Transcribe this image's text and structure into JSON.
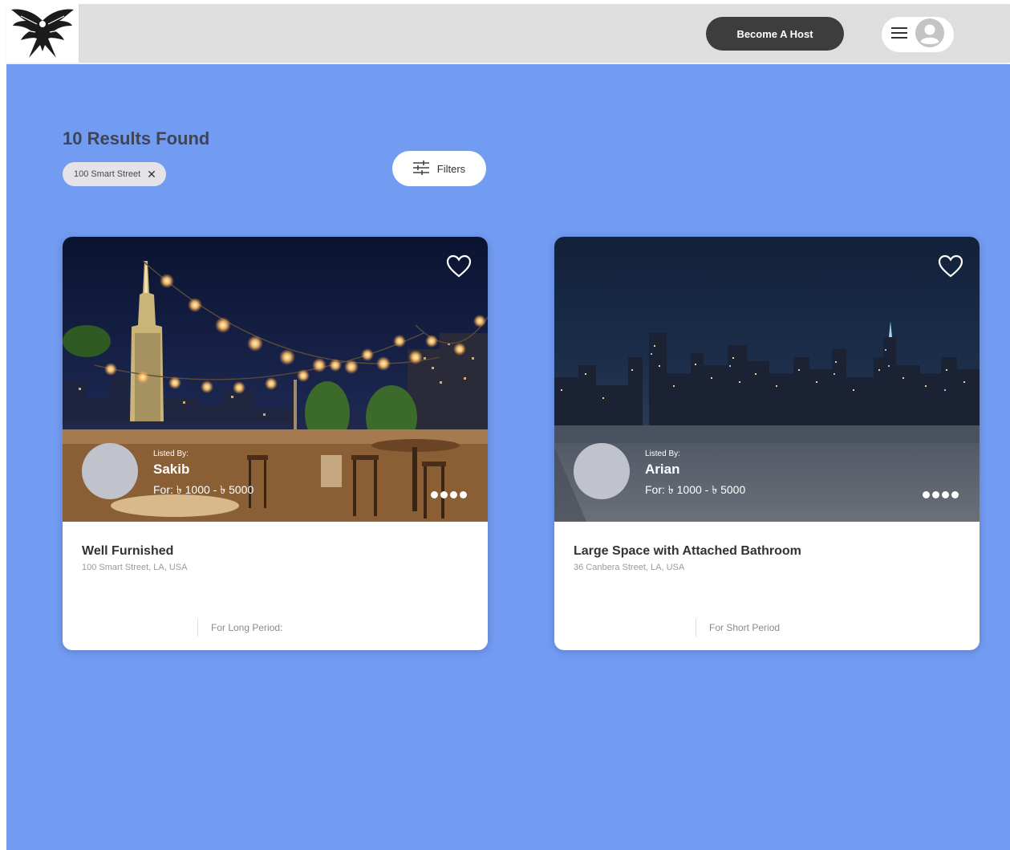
{
  "header": {
    "logo_icon": "eagle-logo",
    "become_host_label": "Become A Host",
    "menu_icon": "hamburger-menu-icon",
    "avatar_icon": "user-avatar-icon"
  },
  "search": {
    "results_title": "10 Results Found",
    "active_filter_chip": "100 Smart Street",
    "chip_remove_icon": "close-icon",
    "filters_label": "Filters",
    "filters_icon": "sliders-icon"
  },
  "listings": [
    {
      "listed_by_label": "Listed By:",
      "host_name": "Sakib",
      "price": "For: ৳ 1000  -  ৳ 5000",
      "title": "Well Furnished",
      "address": "100 Smart Street, LA, USA",
      "period": "For Long Period:",
      "image": "rooftop-bar-night-with-string-lights"
    },
    {
      "listed_by_label": "Listed By:",
      "host_name": "Arian",
      "price": "For: ৳ 1000  -  ৳ 5000",
      "title": "Large Space with Attached Bathroom",
      "address": "36 Canbera Street, LA, USA",
      "period": "For Short Period",
      "image": "empty-rooftop-city-skyline-night"
    }
  ],
  "colors": {
    "page_background": "#729bf2",
    "header_background": "#dedede",
    "host_button": "#3d3d3d",
    "card_background": "#ffffff",
    "title_text": "#3f4456"
  }
}
